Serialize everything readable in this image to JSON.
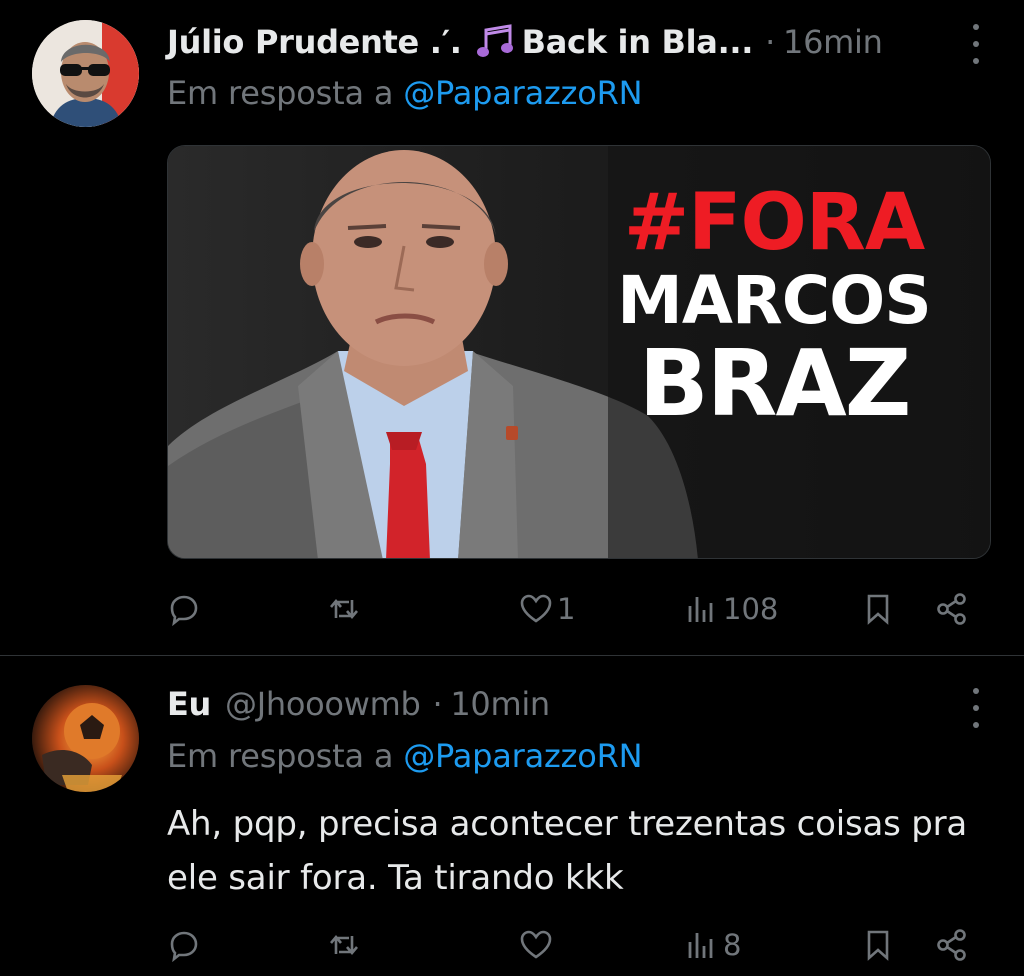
{
  "posts": [
    {
      "display_name": "Júlio Prudente .′.",
      "name_suffix": "Back in Bla...",
      "handle": "",
      "dot": "·",
      "time": "16min",
      "reply_prefix": "Em resposta a ",
      "reply_mention": "@PaparazzoRN",
      "media_text": {
        "hashtag": "#FORA",
        "line2": "MARCOS",
        "line3": "BRAZ"
      },
      "actions": {
        "replies": "",
        "reposts": "",
        "likes": "1",
        "views": "108"
      },
      "icons": [
        "avatar",
        "music-note-icon",
        "more-icon",
        "reply-icon",
        "repost-icon",
        "like-icon",
        "views-icon",
        "bookmark-icon",
        "share-icon"
      ]
    },
    {
      "display_name": "Eu",
      "handle": "@Jhooowmb",
      "dot": "·",
      "time": "10min",
      "reply_prefix": "Em resposta a ",
      "reply_mention": "@PaparazzoRN",
      "text": "Ah, pqp, precisa acontecer trezentas coisas pra ele sair fora. Ta tirando kkk",
      "actions": {
        "replies": "",
        "reposts": "",
        "likes": "",
        "views": "8"
      }
    }
  ],
  "colors": {
    "background": "#000000",
    "text": "#e7e9ea",
    "muted": "#71767b",
    "mention": "#1d9bf0",
    "hashtag_red": "#ee1c24",
    "divider": "#2f3336"
  }
}
